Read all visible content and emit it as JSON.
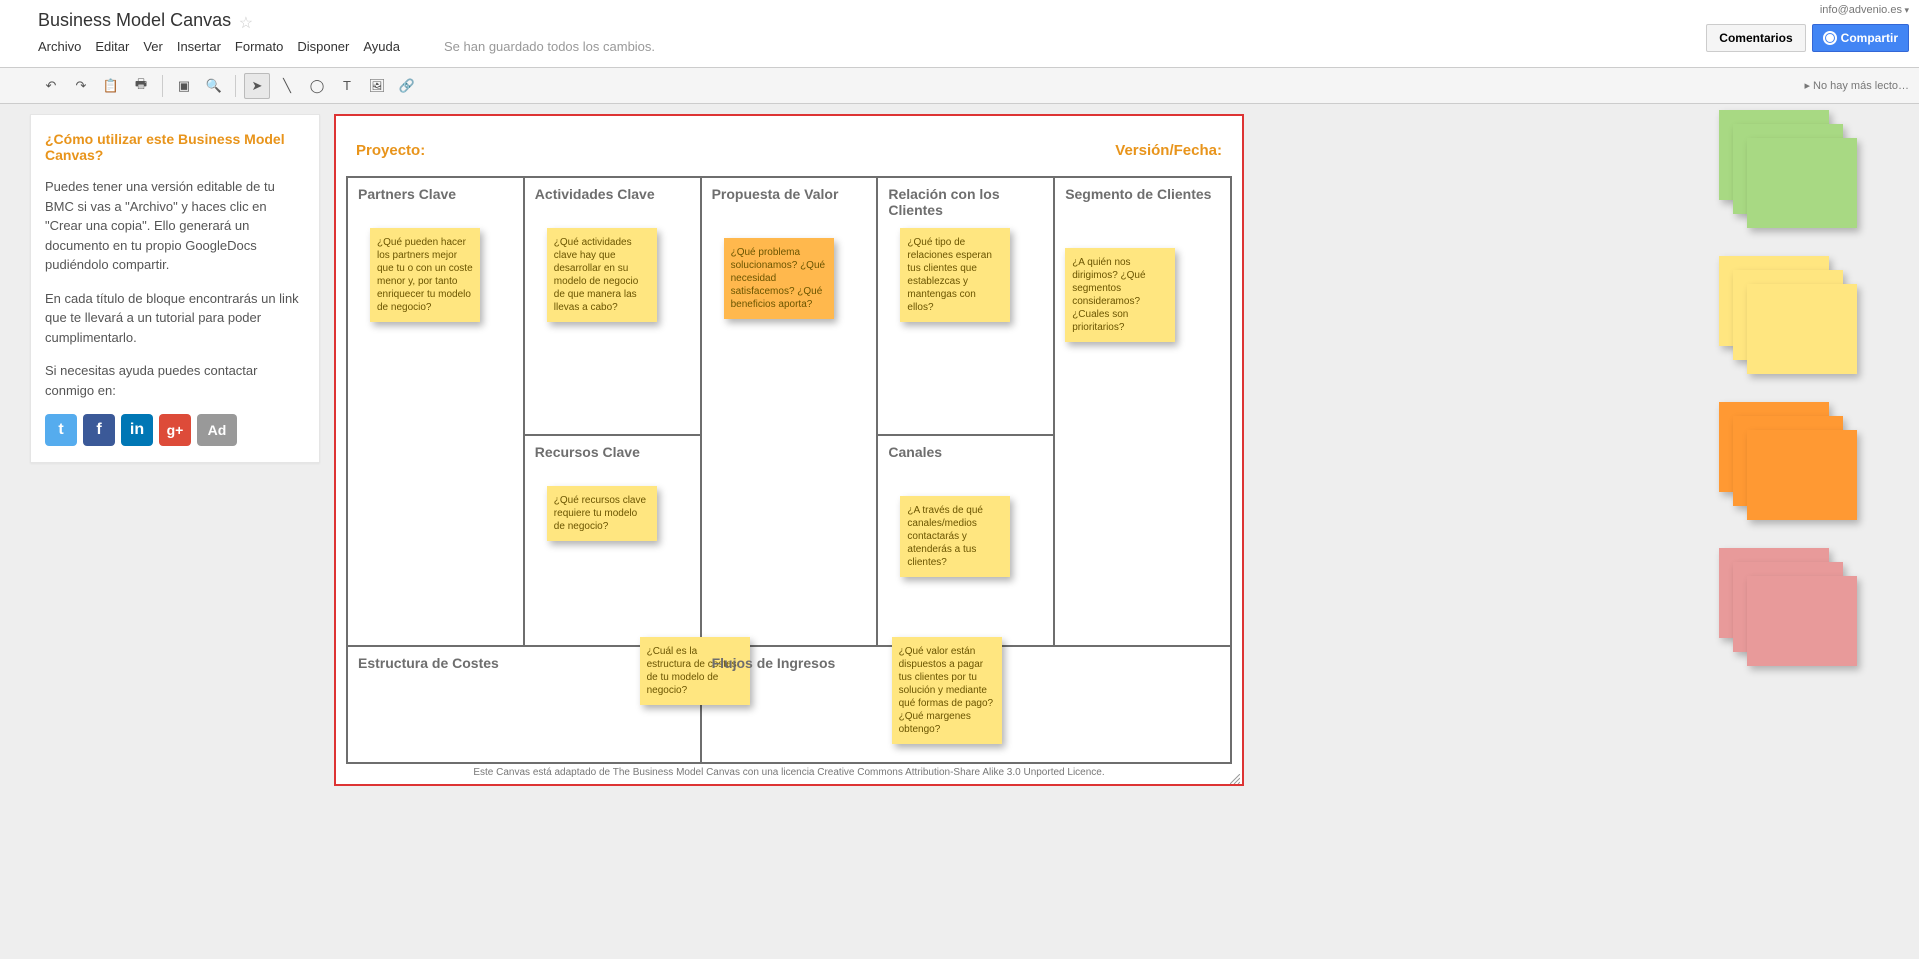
{
  "user_email": "info@advenio.es",
  "doc_title": "Business Model Canvas",
  "menu": {
    "archivo": "Archivo",
    "editar": "Editar",
    "ver": "Ver",
    "insertar": "Insertar",
    "formato": "Formato",
    "disponer": "Disponer",
    "ayuda": "Ayuda"
  },
  "save_status": "Se han guardado todos los cambios.",
  "buttons": {
    "comments": "Comentarios",
    "share": "Compartir"
  },
  "readers_status": "No hay más lecto…",
  "sidebar": {
    "title": "¿Cómo utilizar este Business Model Canvas?",
    "p1": "Puedes tener una versión editable de tu BMC si vas a \"Archivo\" y haces clic en \"Crear una copia\". Ello generará un documento en tu propio GoogleDocs pudiéndolo compartir.",
    "p2": "En cada título de bloque encontrarás un link que te llevará a un tutorial para poder cumplimentarlo.",
    "p3": "Si necesitas ayuda puedes contactar conmigo en:"
  },
  "social": {
    "tw": "t",
    "fb": "f",
    "li": "in",
    "gp": "g+",
    "ad": "Ad"
  },
  "canvas": {
    "proyecto": "Proyecto:",
    "version": "Versión/Fecha:",
    "cells": {
      "partners": "Partners Clave",
      "actividades": "Actividades Clave",
      "propuesta": "Propuesta de Valor",
      "relacion": "Relación con los Clientes",
      "segmento": "Segmento de Clientes",
      "recursos": "Recursos Clave",
      "canales": "Canales",
      "costes": "Estructura de Costes",
      "ingresos": "Flujos de Ingresos"
    },
    "stickies": {
      "partners": "¿Qué pueden hacer los partners mejor que tu o con un coste menor y, por tanto enriquecer tu modelo de negocio?",
      "actividades": "¿Qué actividades clave hay que desarrollar en su modelo de negocio de que manera las llevas a cabo?",
      "propuesta": "¿Qué problema solucionamos? ¿Qué necesidad satisfacemos? ¿Qué beneficios aporta?",
      "relacion": "¿Qué tipo de relaciones esperan tus clientes que establezcas y mantengas con ellos?",
      "segmento": "¿A quién nos dirigimos? ¿Qué segmentos consideramos? ¿Cuales son prioritarios?",
      "recursos": "¿Qué recursos clave requiere tu modelo de negocio?",
      "canales": "¿A través de qué canales/medios contactarás y atenderás a tus clientes?",
      "costes": "¿Cuál es la estructura de costes de tu modelo de negocio?",
      "ingresos": "¿Qué valor están dispuestos a pagar tus clientes por tu solución y mediante qué formas de pago? ¿Qué margenes obtengo?"
    },
    "footer": "Este Canvas está adaptado de The Business Model Canvas con una licencia Creative Commons Attribution-Share Alike 3.0 Unported Licence."
  }
}
